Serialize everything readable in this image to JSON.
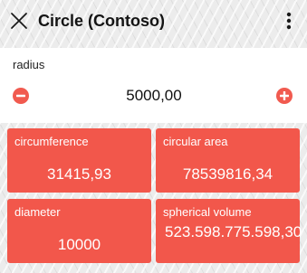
{
  "app_bar": {
    "title": "Circle (Contoso)",
    "close_icon": "close-icon",
    "menu_icon": "more-vert-icon"
  },
  "input": {
    "label": "radius",
    "value": "5000,00",
    "decrement_icon": "minus-circle-icon",
    "increment_icon": "plus-circle-icon"
  },
  "results": [
    {
      "label": "circumference",
      "value": "31415,93"
    },
    {
      "label": "circular area",
      "value": "78539816,34"
    },
    {
      "label": "diameter",
      "value": "10000"
    },
    {
      "label": "spherical volume",
      "value": "523.598.775.598,30"
    }
  ],
  "colors": {
    "accent": "#f2574b",
    "background": "#ececec",
    "text": "#141414"
  }
}
